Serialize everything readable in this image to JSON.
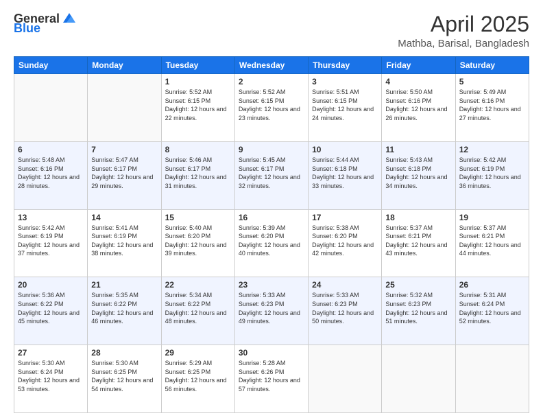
{
  "logo": {
    "general": "General",
    "blue": "Blue"
  },
  "title": "April 2025",
  "subtitle": "Mathba, Barisal, Bangladesh",
  "days_header": [
    "Sunday",
    "Monday",
    "Tuesday",
    "Wednesday",
    "Thursday",
    "Friday",
    "Saturday"
  ],
  "weeks": [
    [
      {
        "day": "",
        "info": ""
      },
      {
        "day": "",
        "info": ""
      },
      {
        "day": "1",
        "info": "Sunrise: 5:52 AM\nSunset: 6:15 PM\nDaylight: 12 hours and 22 minutes."
      },
      {
        "day": "2",
        "info": "Sunrise: 5:52 AM\nSunset: 6:15 PM\nDaylight: 12 hours and 23 minutes."
      },
      {
        "day": "3",
        "info": "Sunrise: 5:51 AM\nSunset: 6:15 PM\nDaylight: 12 hours and 24 minutes."
      },
      {
        "day": "4",
        "info": "Sunrise: 5:50 AM\nSunset: 6:16 PM\nDaylight: 12 hours and 26 minutes."
      },
      {
        "day": "5",
        "info": "Sunrise: 5:49 AM\nSunset: 6:16 PM\nDaylight: 12 hours and 27 minutes."
      }
    ],
    [
      {
        "day": "6",
        "info": "Sunrise: 5:48 AM\nSunset: 6:16 PM\nDaylight: 12 hours and 28 minutes."
      },
      {
        "day": "7",
        "info": "Sunrise: 5:47 AM\nSunset: 6:17 PM\nDaylight: 12 hours and 29 minutes."
      },
      {
        "day": "8",
        "info": "Sunrise: 5:46 AM\nSunset: 6:17 PM\nDaylight: 12 hours and 31 minutes."
      },
      {
        "day": "9",
        "info": "Sunrise: 5:45 AM\nSunset: 6:17 PM\nDaylight: 12 hours and 32 minutes."
      },
      {
        "day": "10",
        "info": "Sunrise: 5:44 AM\nSunset: 6:18 PM\nDaylight: 12 hours and 33 minutes."
      },
      {
        "day": "11",
        "info": "Sunrise: 5:43 AM\nSunset: 6:18 PM\nDaylight: 12 hours and 34 minutes."
      },
      {
        "day": "12",
        "info": "Sunrise: 5:42 AM\nSunset: 6:19 PM\nDaylight: 12 hours and 36 minutes."
      }
    ],
    [
      {
        "day": "13",
        "info": "Sunrise: 5:42 AM\nSunset: 6:19 PM\nDaylight: 12 hours and 37 minutes."
      },
      {
        "day": "14",
        "info": "Sunrise: 5:41 AM\nSunset: 6:19 PM\nDaylight: 12 hours and 38 minutes."
      },
      {
        "day": "15",
        "info": "Sunrise: 5:40 AM\nSunset: 6:20 PM\nDaylight: 12 hours and 39 minutes."
      },
      {
        "day": "16",
        "info": "Sunrise: 5:39 AM\nSunset: 6:20 PM\nDaylight: 12 hours and 40 minutes."
      },
      {
        "day": "17",
        "info": "Sunrise: 5:38 AM\nSunset: 6:20 PM\nDaylight: 12 hours and 42 minutes."
      },
      {
        "day": "18",
        "info": "Sunrise: 5:37 AM\nSunset: 6:21 PM\nDaylight: 12 hours and 43 minutes."
      },
      {
        "day": "19",
        "info": "Sunrise: 5:37 AM\nSunset: 6:21 PM\nDaylight: 12 hours and 44 minutes."
      }
    ],
    [
      {
        "day": "20",
        "info": "Sunrise: 5:36 AM\nSunset: 6:22 PM\nDaylight: 12 hours and 45 minutes."
      },
      {
        "day": "21",
        "info": "Sunrise: 5:35 AM\nSunset: 6:22 PM\nDaylight: 12 hours and 46 minutes."
      },
      {
        "day": "22",
        "info": "Sunrise: 5:34 AM\nSunset: 6:22 PM\nDaylight: 12 hours and 48 minutes."
      },
      {
        "day": "23",
        "info": "Sunrise: 5:33 AM\nSunset: 6:23 PM\nDaylight: 12 hours and 49 minutes."
      },
      {
        "day": "24",
        "info": "Sunrise: 5:33 AM\nSunset: 6:23 PM\nDaylight: 12 hours and 50 minutes."
      },
      {
        "day": "25",
        "info": "Sunrise: 5:32 AM\nSunset: 6:23 PM\nDaylight: 12 hours and 51 minutes."
      },
      {
        "day": "26",
        "info": "Sunrise: 5:31 AM\nSunset: 6:24 PM\nDaylight: 12 hours and 52 minutes."
      }
    ],
    [
      {
        "day": "27",
        "info": "Sunrise: 5:30 AM\nSunset: 6:24 PM\nDaylight: 12 hours and 53 minutes."
      },
      {
        "day": "28",
        "info": "Sunrise: 5:30 AM\nSunset: 6:25 PM\nDaylight: 12 hours and 54 minutes."
      },
      {
        "day": "29",
        "info": "Sunrise: 5:29 AM\nSunset: 6:25 PM\nDaylight: 12 hours and 56 minutes."
      },
      {
        "day": "30",
        "info": "Sunrise: 5:28 AM\nSunset: 6:26 PM\nDaylight: 12 hours and 57 minutes."
      },
      {
        "day": "",
        "info": ""
      },
      {
        "day": "",
        "info": ""
      },
      {
        "day": "",
        "info": ""
      }
    ]
  ]
}
